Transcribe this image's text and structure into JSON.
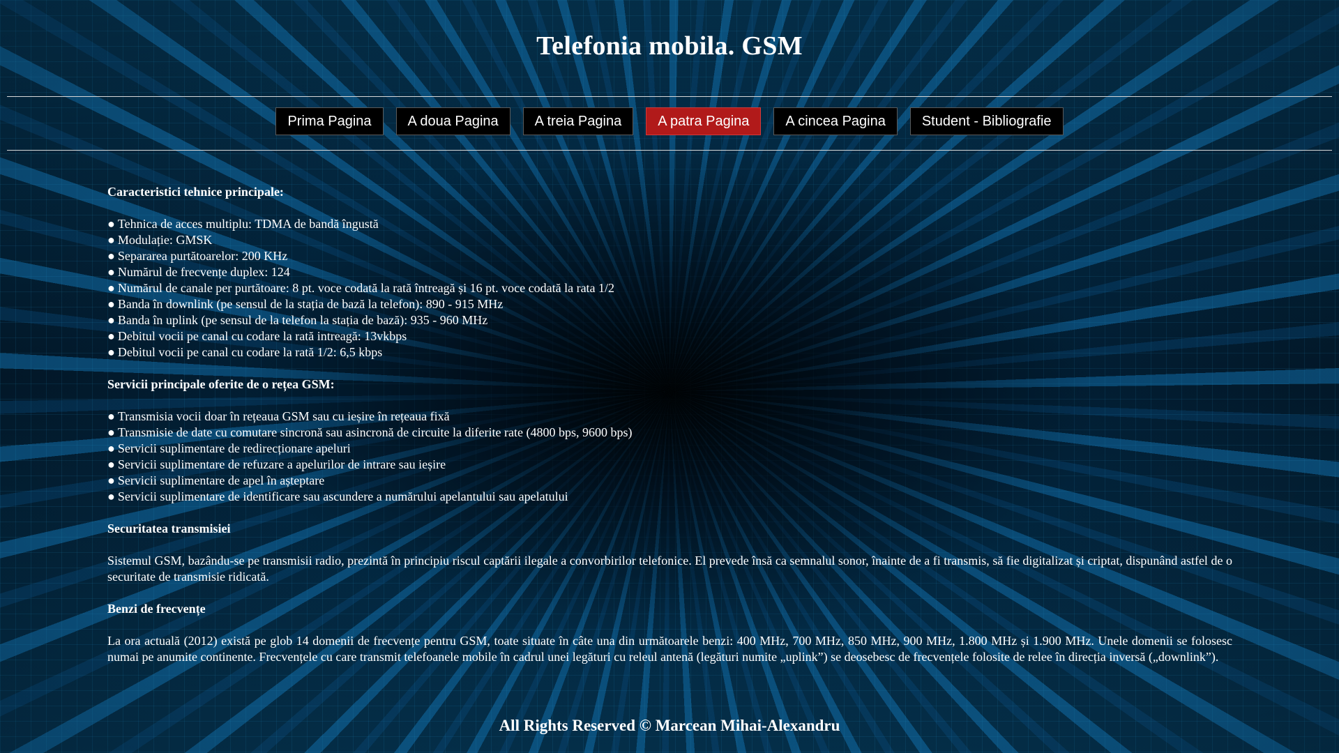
{
  "site_title": "Telefonia mobila. GSM",
  "nav": {
    "items": [
      {
        "label": "Prima Pagina"
      },
      {
        "label": "A doua Pagina"
      },
      {
        "label": "A treia Pagina"
      },
      {
        "label": "A patra Pagina",
        "active": true
      },
      {
        "label": "A cincea Pagina"
      },
      {
        "label": "Student - Bibliografie"
      }
    ],
    "active_color": "#b11a1a"
  },
  "sections": {
    "tech": {
      "heading": "Caracteristici tehnice principale:",
      "bullet": "●",
      "items": [
        "Tehnica de acces multiplu: TDMA de bandă îngustă",
        "Modulație: GMSK",
        "Separarea purtătoarelor: 200 KHz",
        "Numărul de frecvențe duplex: 124",
        "Numărul de canale per purtătoare: 8 pt. voce codată la rată întreagă și 16 pt. voce codată la rata 1/2",
        "Banda în downlink (pe sensul de la stația de bază la telefon): 890 - 915 MHz",
        "Banda în uplink (pe sensul de la telefon la stația de bază): 935 - 960 MHz",
        "Debitul vocii pe canal cu codare la rată intreagă: 13vkbps",
        "Debitul vocii pe canal cu codare la rată 1/2: 6,5 kbps"
      ]
    },
    "services": {
      "heading": "Servicii principale oferite de o rețea GSM:",
      "bullet": "●",
      "items": [
        "Transmisia vocii doar în rețeaua GSM sau cu ieșire în rețeaua fixă",
        "Transmisie de date cu comutare sincronă sau asincronă de circuite la diferite rate (4800 bps, 9600 bps)",
        "Servicii suplimentare de redirecționare apeluri",
        "Servicii suplimentare de refuzare a apelurilor de intrare sau ieșire",
        "Servicii suplimentare de apel în așteptare",
        "Servicii suplimentare de identificare sau ascundere a numărului apelantului sau apelatului"
      ]
    },
    "security": {
      "heading": "Securitatea transmisiei",
      "text": "Sistemul GSM, bazându-se pe transmisii radio, prezintă în principiu riscul captării ilegale a convorbirilor telefonice. El prevede însă ca semnalul sonor, înainte de a fi transmis, să fie digitalizat și criptat, dispunând astfel de o securitate de transmisie ridicată."
    },
    "bands": {
      "heading": "Benzi de frecvențe",
      "text": "La ora actuală (2012) există pe glob 14 domenii de frecvențe pentru GSM, toate situate în câte una din următoarele benzi: 400 MHz, 700 MHz, 850 MHz, 900 MHz, 1.800 MHz și 1.900 MHz. Unele domenii se folosesc numai pe anumite continente. Frecvențele cu care transmit telefoanele mobile în cadrul unei legături cu releul antenă (legături numite „uplink”) se deosebesc de frecvențele folosite de relee în direcția inversă („downlink”)."
    }
  },
  "footer": "All Rights Reserved © Marcean Mihai-Alexandru"
}
